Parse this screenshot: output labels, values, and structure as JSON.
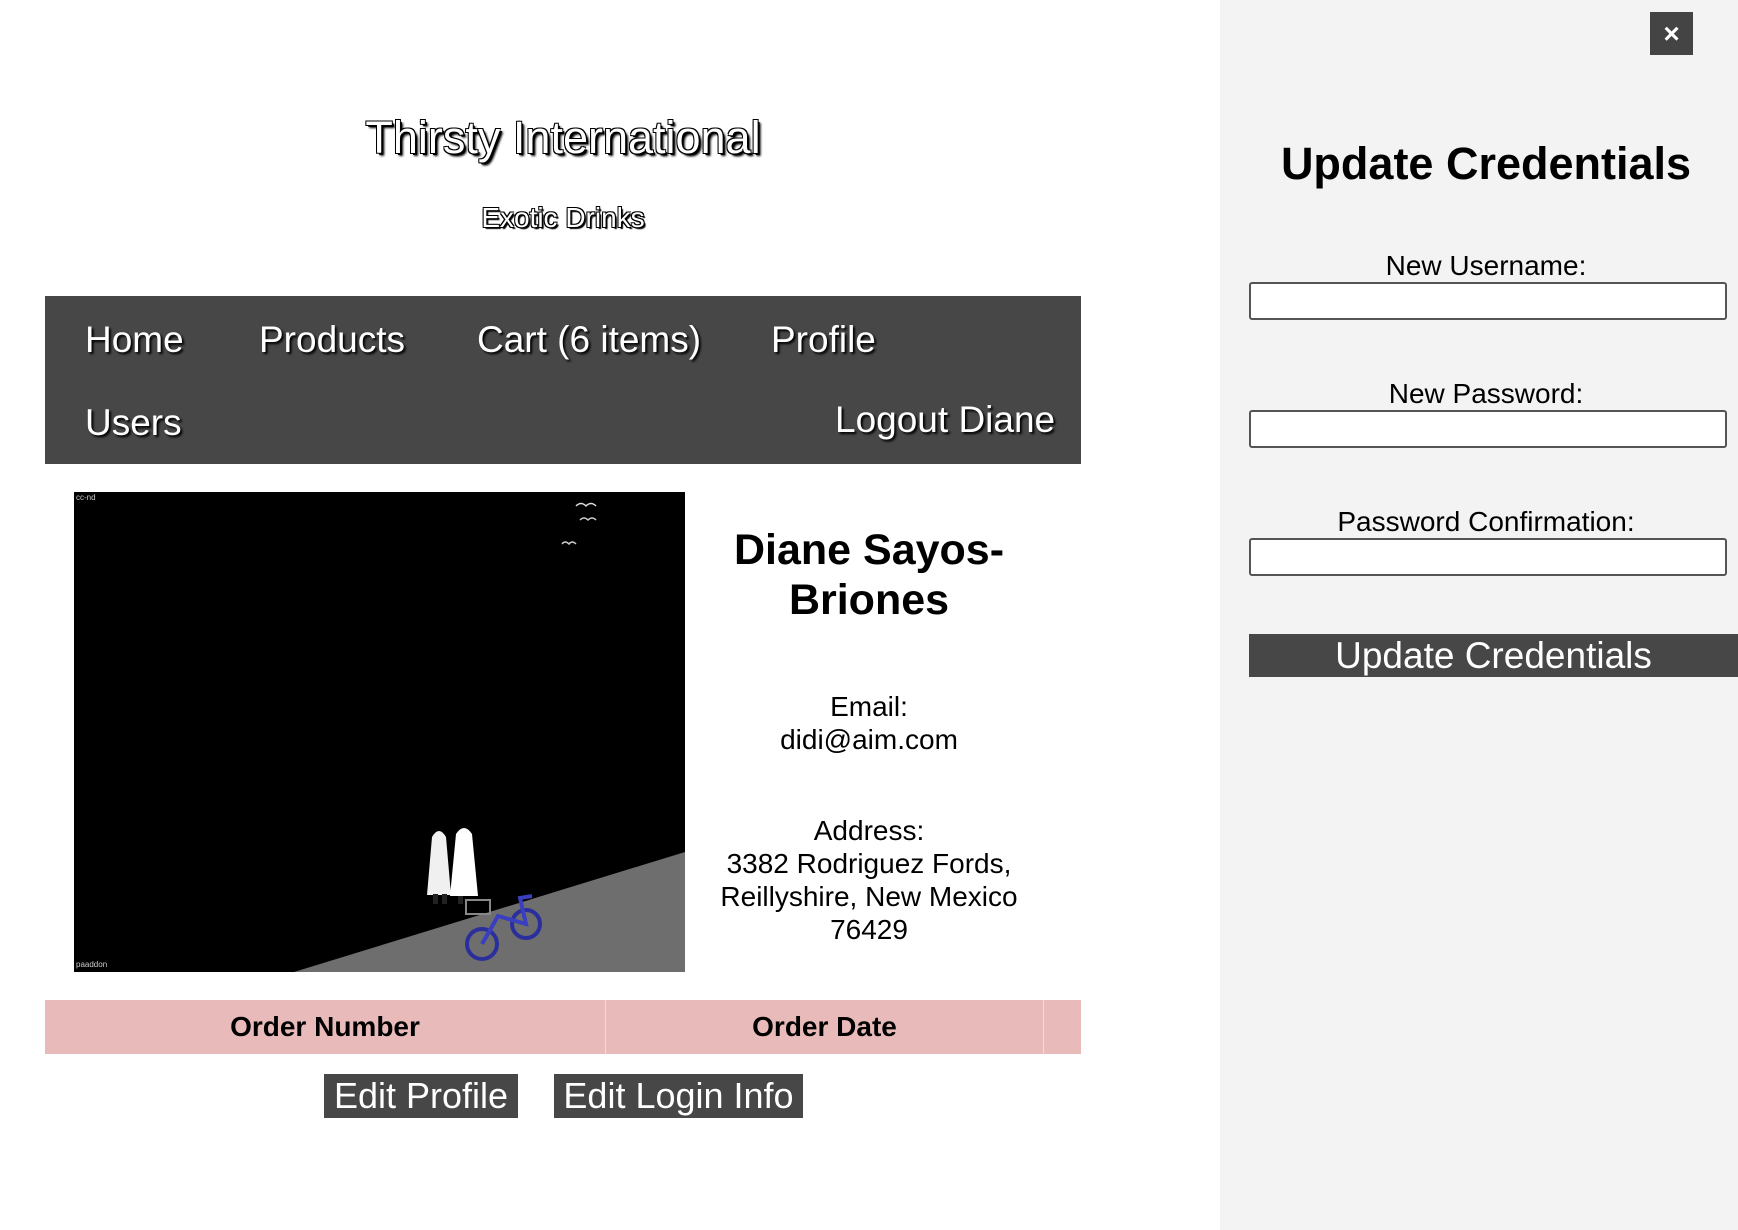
{
  "header": {
    "title": "Thirsty International",
    "subtitle": "Exotic Drinks"
  },
  "nav": {
    "home": "Home",
    "products": "Products",
    "cart": "Cart (6 items)",
    "profile": "Profile",
    "users": "Users",
    "logout": "Logout Diane"
  },
  "photo": {
    "license_tag": "cc-nd",
    "credit_tag": "paaddon"
  },
  "profile": {
    "name": "Diane Sayos-Briones",
    "email_label": "Email:",
    "email": "didi@aim.com",
    "address_label": "Address:",
    "address_line1": "3382 Rodriguez Fords,",
    "address_line2": "Reillyshire, New Mexico",
    "address_line3": "76429"
  },
  "orders": {
    "columns": [
      "Order Number",
      "Order Date"
    ]
  },
  "actions": {
    "edit_profile": "Edit Profile",
    "edit_login": "Edit Login Info"
  },
  "panel": {
    "close_symbol": "×",
    "title": "Update Credentials",
    "username_label": "New Username:",
    "password_label": "New Password:",
    "confirm_label": "Password Confirmation:",
    "submit_label": "Update Credentials"
  },
  "colors": {
    "nav_bg": "#474747",
    "panel_bg": "#f3f3f3",
    "table_header_bg": "#e8baba"
  },
  "icons": [
    "close-icon"
  ]
}
